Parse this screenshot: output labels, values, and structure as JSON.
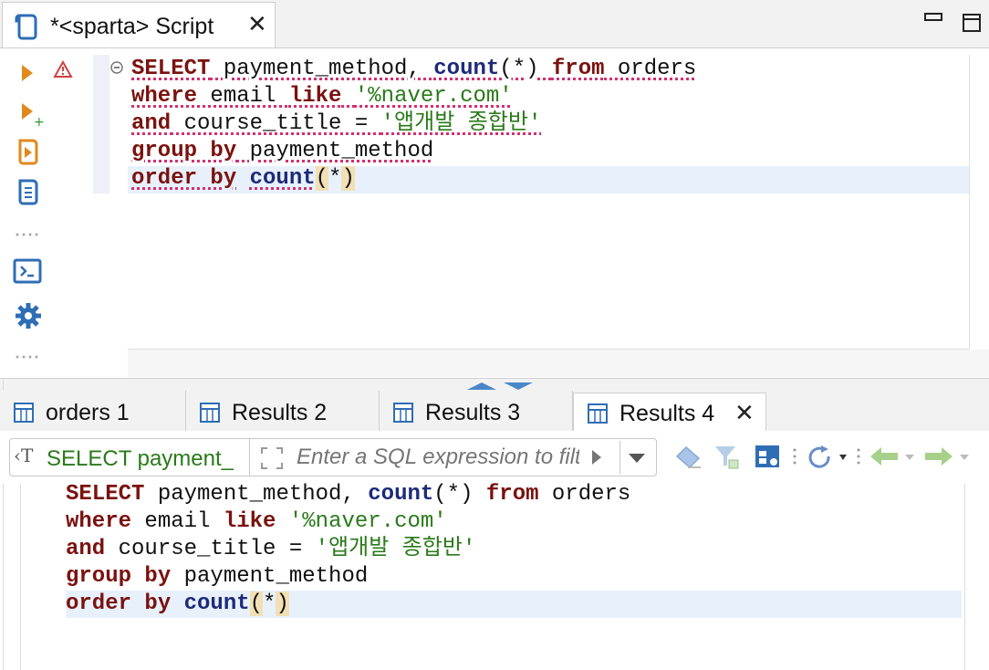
{
  "editor_tab": {
    "title": "*<sparta> Script",
    "close_glyph": "✕"
  },
  "window_controls": {
    "minimize": "▭",
    "maximize": "☐"
  },
  "sql_lines": [
    [
      {
        "t": "SELECT",
        "c": "kw"
      },
      {
        "t": " payment_method, ",
        "c": "plain"
      },
      {
        "t": "count",
        "c": "fn"
      },
      {
        "t": "(*) ",
        "c": "plain"
      },
      {
        "t": "from",
        "c": "kw"
      },
      {
        "t": " orders",
        "c": "plain"
      }
    ],
    [
      {
        "t": "where",
        "c": "kw"
      },
      {
        "t": " email ",
        "c": "plain"
      },
      {
        "t": "like",
        "c": "kw"
      },
      {
        "t": " ",
        "c": "plain"
      },
      {
        "t": "'%naver.com'",
        "c": "str"
      }
    ],
    [
      {
        "t": "and",
        "c": "kw"
      },
      {
        "t": " course_title = ",
        "c": "plain"
      },
      {
        "t": "'앱개발 종합반'",
        "c": "str"
      }
    ],
    [
      {
        "t": "group by",
        "c": "kw"
      },
      {
        "t": " payment_method",
        "c": "plain"
      }
    ],
    [
      {
        "t": "order by",
        "c": "kw"
      },
      {
        "t": " ",
        "c": "plain"
      },
      {
        "t": "count",
        "c": "fn"
      },
      {
        "t": "(",
        "c": "paren"
      },
      {
        "t": "*",
        "c": "plain"
      },
      {
        "t": ")",
        "c": "paren"
      }
    ]
  ],
  "result_tabs": [
    {
      "label": "orders 1",
      "active": false
    },
    {
      "label": "Results 2",
      "active": false
    },
    {
      "label": "Results 3",
      "active": false
    },
    {
      "label": "Results 4",
      "active": true,
      "close_glyph": "✕"
    }
  ],
  "filter": {
    "query_label": "SELECT payment_",
    "placeholder": "Enter a SQL expression to filter results (use Ctrl+Space)"
  },
  "colors": {
    "keyword": "#7a1210",
    "function": "#1d2a7a",
    "string": "#2a7a1a",
    "current_line": "#e8f0fb",
    "icon_blue": "#2f6db5",
    "icon_orange": "#e08a1e"
  }
}
